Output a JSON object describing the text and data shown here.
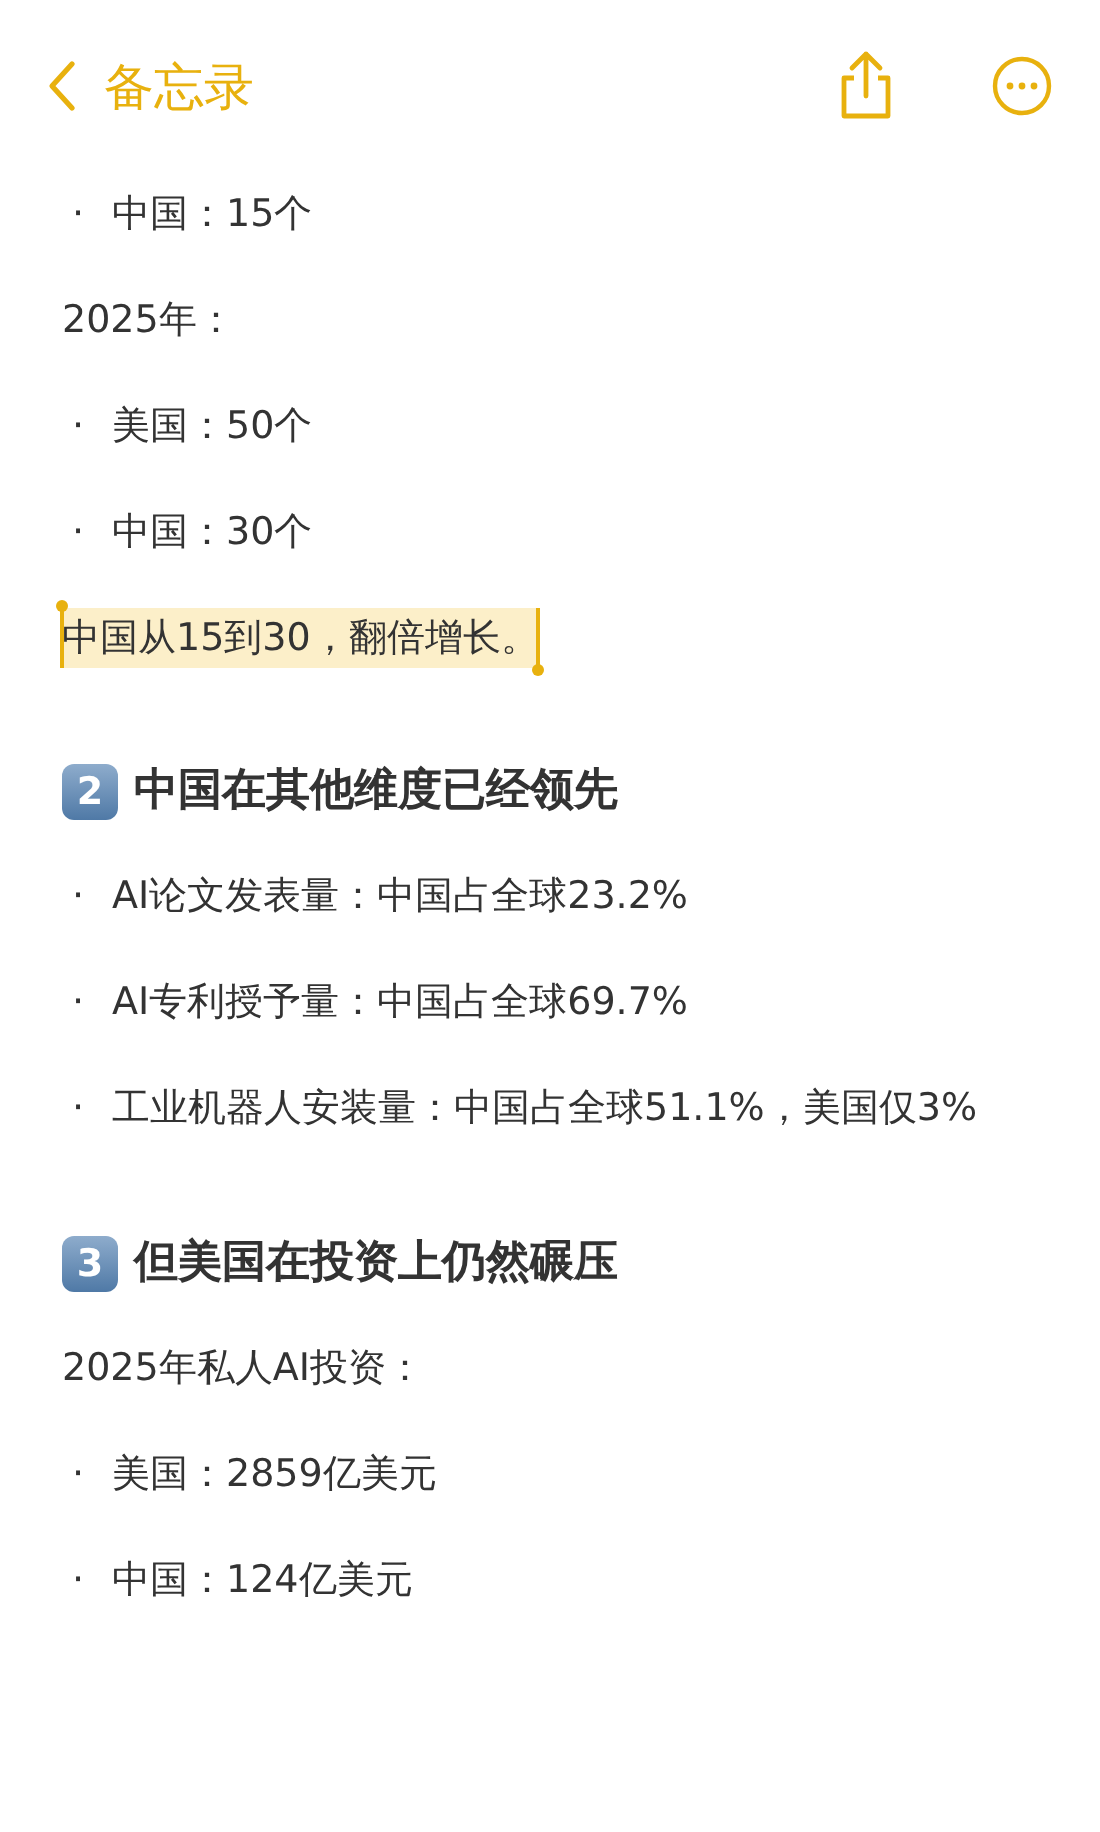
{
  "nav": {
    "back_label": "备忘录"
  },
  "blocks": [
    {
      "kind": "bullet",
      "marker": "·",
      "text": "中国：15个"
    },
    {
      "kind": "para",
      "text": "2025年："
    },
    {
      "kind": "bullet",
      "marker": "·",
      "text": "美国：50个"
    },
    {
      "kind": "bullet",
      "marker": "·",
      "text": "中国：30个"
    },
    {
      "kind": "para",
      "text": "中国从15到30，翻倍增长。",
      "selected": true
    },
    {
      "kind": "heading",
      "badge": "2",
      "text": "中国在其他维度已经领先"
    },
    {
      "kind": "bullet",
      "marker": "·",
      "text": "AI论文发表量：中国占全球23.2%"
    },
    {
      "kind": "bullet",
      "marker": "·",
      "text": "AI专利授予量：中国占全球69.7%"
    },
    {
      "kind": "bullet",
      "marker": "·",
      "text": "工业机器人安装量：中国占全球51.1%，美国仅3%"
    },
    {
      "kind": "heading",
      "badge": "3",
      "text": "但美国在投资上仍然碾压"
    },
    {
      "kind": "para",
      "text": "2025年私人AI投资："
    },
    {
      "kind": "bullet",
      "marker": "·",
      "text": "美国：2859亿美元"
    },
    {
      "kind": "bullet",
      "marker": "·",
      "text": "中国：124亿美元"
    }
  ]
}
